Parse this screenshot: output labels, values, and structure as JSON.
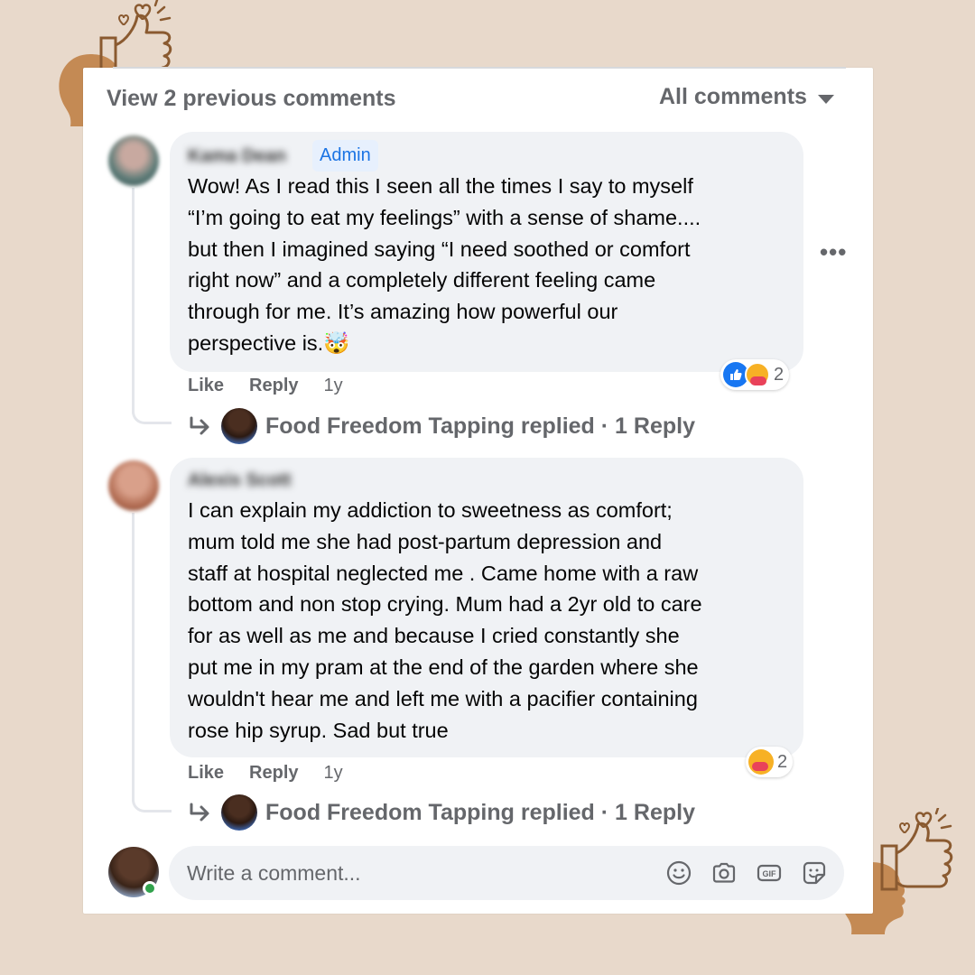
{
  "header": {
    "view_previous": "View 2 previous comments",
    "sort_label": "All comments"
  },
  "comments": [
    {
      "author": "Kama Dean",
      "badge": "Admin",
      "text": "Wow! As I read this I seen all the times I say to myself\n“I’m going to eat my feelings” with a sense of shame....\nbut then I imagined saying “I need soothed or comfort\nright now” and a completely different feeling came\nthrough for me. It’s amazing how powerful our\nperspective is.🤯",
      "reactions": {
        "types": [
          "like",
          "care"
        ],
        "count": "2"
      },
      "like_label": "Like",
      "reply_label": "Reply",
      "time": "1y",
      "replied": {
        "name": "Food Freedom Tapping replied",
        "sep": " · ",
        "count": "1 Reply"
      }
    },
    {
      "author": "Alexis Scott",
      "text": "I can explain my addiction to sweetness as comfort;\nmum told me she had post-partum depression and\nstaff at hospital neglected me . Came home with a raw\nbottom and non stop crying. Mum had a 2yr old to care\nfor as well as me and because I cried constantly she\nput me in my pram at the end of the garden where she\nwouldn't hear me and left me with a pacifier containing\nrose hip syrup. Sad but true",
      "reactions": {
        "types": [
          "care"
        ],
        "count": "2"
      },
      "like_label": "Like",
      "reply_label": "Reply",
      "time": "1y",
      "replied": {
        "name": "Food Freedom Tapping replied",
        "sep": " · ",
        "count": "1 Reply"
      }
    }
  ],
  "composer": {
    "placeholder": "Write a comment...",
    "icons": [
      "emoji-icon",
      "camera-icon",
      "gif-icon",
      "sticker-icon"
    ]
  },
  "colors": {
    "background": "#e8d9cb",
    "bubble": "#f0f2f5",
    "secondary_text": "#65676b",
    "accent_blue": "#1877f2",
    "deco_brown": "#c48a54"
  }
}
